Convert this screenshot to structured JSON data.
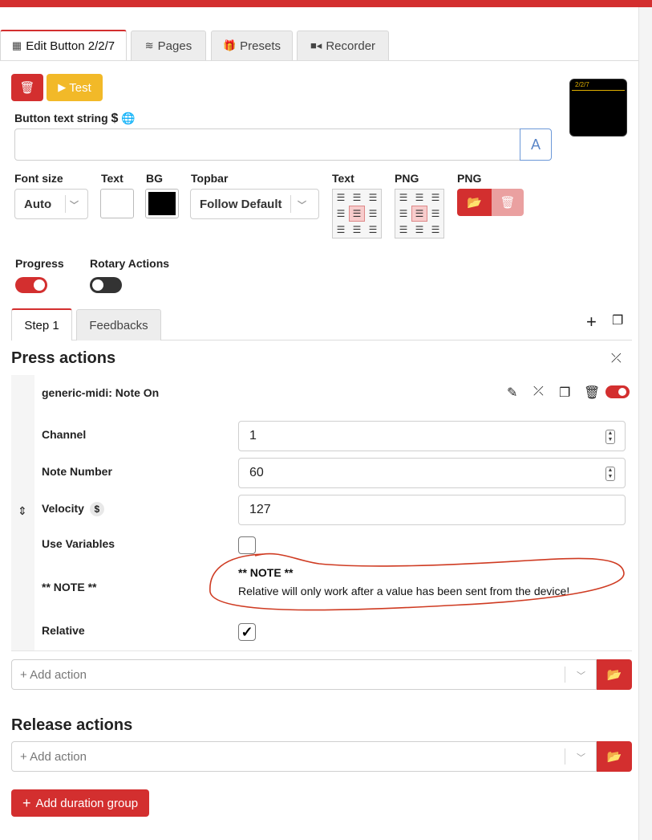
{
  "tabs": [
    {
      "label": "Edit Button 2/2/7",
      "icon": "calculator-icon"
    },
    {
      "label": "Pages",
      "icon": "layers-icon"
    },
    {
      "label": "Presets",
      "icon": "gift-icon"
    },
    {
      "label": "Recorder",
      "icon": "video-camera-icon"
    }
  ],
  "toolbar": {
    "delete_icon": "trash-icon",
    "test_label": "Test"
  },
  "preview": {
    "text": "2/2/7"
  },
  "button_text": {
    "label": "Button text string",
    "value": ""
  },
  "style": {
    "font_size_label": "Font size",
    "font_size_value": "Auto",
    "text_label": "Text",
    "bg_label": "BG",
    "topbar_label": "Topbar",
    "topbar_value": "Follow Default",
    "text_align_label": "Text",
    "png_align_label": "PNG",
    "png_label": "PNG",
    "text_color": "#ffffff",
    "bg_color": "#000000"
  },
  "options": {
    "progress_label": "Progress",
    "progress_on": true,
    "rotary_label": "Rotary Actions",
    "rotary_on": false
  },
  "step_tabs": [
    {
      "label": "Step 1"
    },
    {
      "label": "Feedbacks"
    }
  ],
  "press": {
    "title": "Press actions",
    "action_title": "generic-midi: Note On",
    "fields": {
      "channel_label": "Channel",
      "channel_value": "1",
      "note_label": "Note Number",
      "note_value": "60",
      "velocity_label": "Velocity",
      "velocity_value": "127",
      "use_vars_label": "Use Variables",
      "use_vars_checked": false,
      "note_heading_label": "** NOTE **",
      "note_body_title": "** NOTE **",
      "note_body_text": "Relative will only work after a value has been sent from the device!",
      "relative_label": "Relative",
      "relative_checked": true
    },
    "add_placeholder": "+ Add action"
  },
  "release": {
    "title": "Release actions",
    "add_placeholder": "+ Add action"
  },
  "add_duration_label": "Add duration group",
  "colors": {
    "accent": "#d32f2f",
    "test": "#f2b928"
  }
}
